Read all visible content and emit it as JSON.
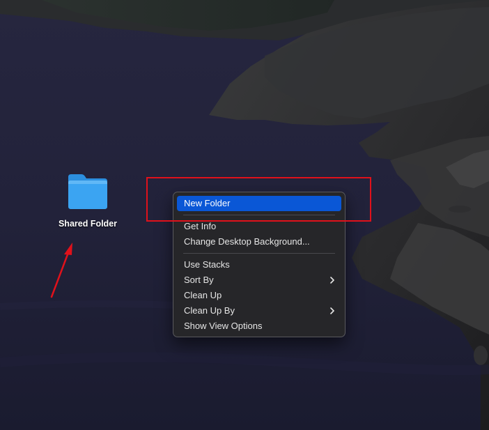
{
  "desktop": {
    "icons": [
      {
        "label": "Shared Folder",
        "icon": "folder-icon",
        "color": "#3ba4f2"
      }
    ]
  },
  "context_menu": {
    "groups": [
      [
        {
          "label": "New Folder",
          "selected": true,
          "submenu": false
        }
      ],
      [
        {
          "label": "Get Info",
          "selected": false,
          "submenu": false
        },
        {
          "label": "Change Desktop Background...",
          "selected": false,
          "submenu": false
        }
      ],
      [
        {
          "label": "Use Stacks",
          "selected": false,
          "submenu": false
        },
        {
          "label": "Sort By",
          "selected": false,
          "submenu": true
        },
        {
          "label": "Clean Up",
          "selected": false,
          "submenu": false
        },
        {
          "label": "Clean Up By",
          "selected": false,
          "submenu": true
        },
        {
          "label": "Show View Options",
          "selected": false,
          "submenu": false
        }
      ]
    ]
  },
  "annotations": {
    "highlight_color": "#e0111b",
    "arrow_color": "#e0111b"
  },
  "colors": {
    "menu_selection": "#0a57d6",
    "menu_background": "#262629"
  }
}
